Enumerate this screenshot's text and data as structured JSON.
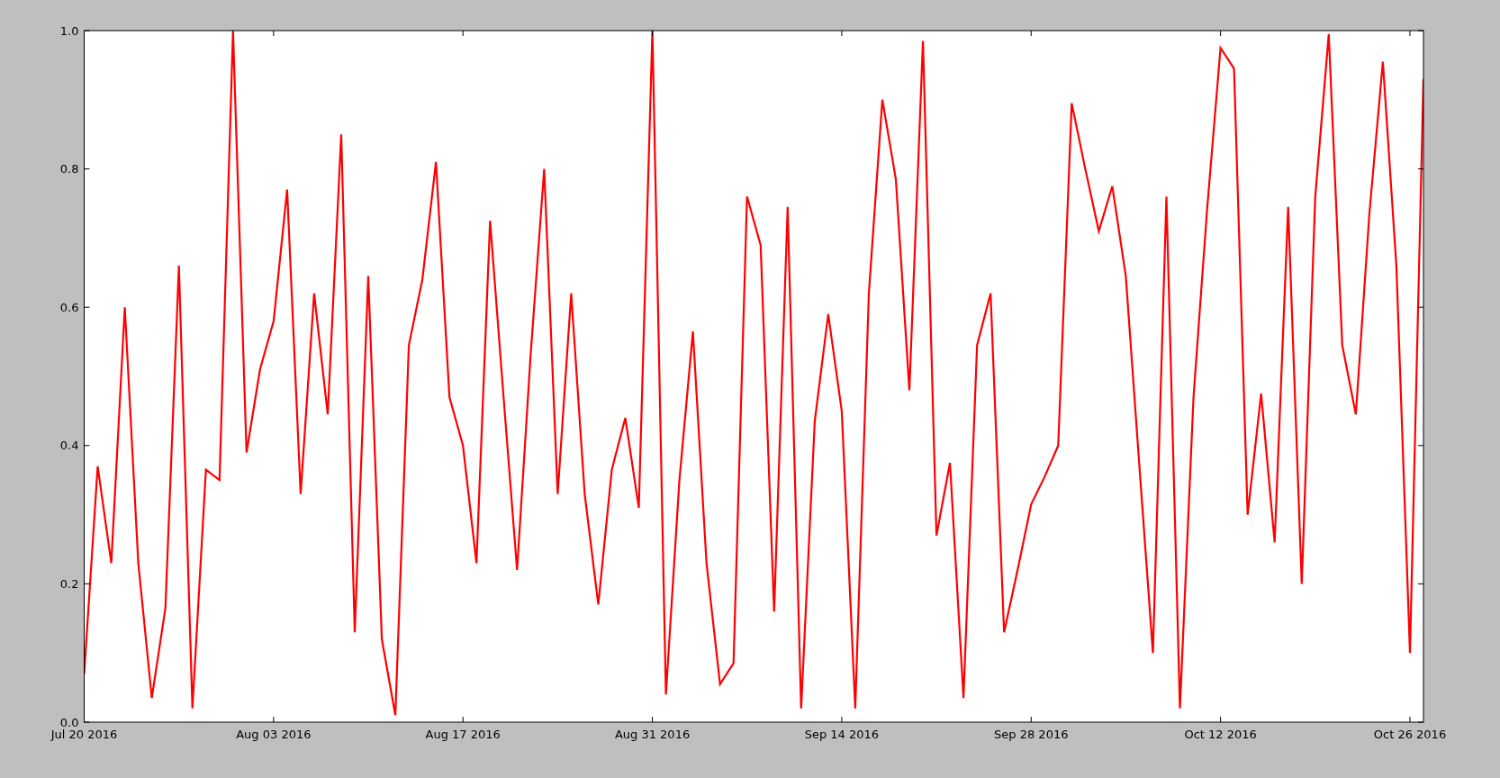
{
  "chart_data": {
    "type": "line",
    "categories": [
      "Jul 20 2016",
      null,
      null,
      null,
      null,
      null,
      null,
      null,
      null,
      null,
      null,
      null,
      null,
      null,
      "Aug 03 2016",
      null,
      null,
      null,
      null,
      null,
      null,
      null,
      null,
      null,
      null,
      null,
      null,
      null,
      "Aug 17 2016",
      null,
      null,
      null,
      null,
      null,
      null,
      null,
      null,
      null,
      null,
      null,
      null,
      null,
      "Aug 31 2016",
      null,
      null,
      null,
      null,
      null,
      null,
      null,
      null,
      null,
      null,
      null,
      null,
      null,
      "Sep 14 2016",
      null,
      null,
      null,
      null,
      null,
      null,
      null,
      null,
      null,
      null,
      null,
      null,
      null,
      "Sep 28 2016",
      null,
      null,
      null,
      null,
      null,
      null,
      null,
      null,
      null,
      null,
      null,
      null,
      null,
      "Oct 12 2016",
      null,
      null,
      null,
      null,
      null,
      null,
      null,
      null,
      null,
      null,
      null,
      null,
      null,
      "Oct 26 2016",
      null
    ],
    "series": [
      {
        "color": "#ff0000",
        "values": [
          0.07,
          0.37,
          0.23,
          0.6,
          0.23,
          0.035,
          0.165,
          0.66,
          0.02,
          0.365,
          0.35,
          1.0,
          0.39,
          0.51,
          0.58,
          0.77,
          0.33,
          0.62,
          0.445,
          0.85,
          0.13,
          0.645,
          0.12,
          0.01,
          0.545,
          0.64,
          0.81,
          0.47,
          0.4,
          0.23,
          0.725,
          0.47,
          0.22,
          0.53,
          0.8,
          0.33,
          0.62,
          0.33,
          0.17,
          0.365,
          0.44,
          0.31,
          1.0,
          0.04,
          0.35,
          0.565,
          0.23,
          0.055,
          0.085,
          0.76,
          0.69,
          0.16,
          0.745,
          0.02,
          0.435,
          0.59,
          0.45,
          0.02,
          0.62,
          0.9,
          0.785,
          0.48,
          0.985,
          0.27,
          0.375,
          0.035,
          0.545,
          0.62,
          0.13,
          0.22,
          0.315,
          0.355,
          0.4,
          0.895,
          0.8,
          0.71,
          0.775,
          0.645,
          0.37,
          0.1,
          0.76,
          0.02,
          0.47,
          0.74,
          0.975,
          0.945,
          0.3,
          0.475,
          0.26,
          0.745,
          0.2,
          0.76,
          0.995,
          0.545,
          0.445,
          0.735,
          0.955,
          0.66,
          0.1,
          0.93
        ]
      }
    ],
    "ylim": [
      0,
      1
    ],
    "yticks": [
      {
        "value": 0,
        "label": "0.0"
      },
      {
        "value": 0.2,
        "label": "0.2"
      },
      {
        "value": 0.4,
        "label": "0.4"
      },
      {
        "value": 0.6,
        "label": "0.6"
      },
      {
        "value": 0.8,
        "label": "0.8"
      },
      {
        "value": 1.0,
        "label": "1.0"
      }
    ]
  }
}
